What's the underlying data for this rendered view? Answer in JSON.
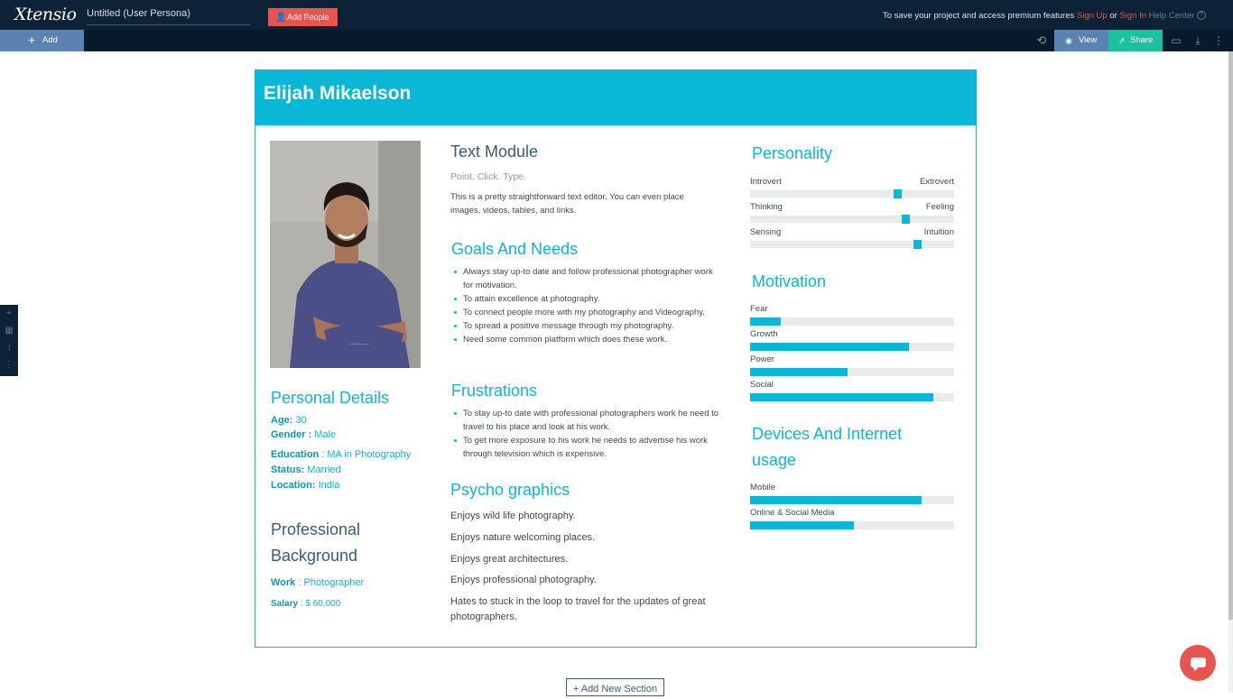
{
  "app": {
    "logo": "Xtensio",
    "doc_title": "Untitled (User Persona)",
    "add_people": "Add People",
    "save_message": "To save your project and access premium features",
    "sign_up": "Sign Up",
    "or": "or",
    "sign_in": "Sign In",
    "help_center": "Help Center"
  },
  "toolbar": {
    "add_label": "Add",
    "view_label": "View",
    "share_label": "Share"
  },
  "persona": {
    "name": "Elijah Mikaelson",
    "personal_details": {
      "title": "Personal Details",
      "age_label": "Age:",
      "age": "30",
      "gender_label": "Gender :",
      "gender": "Male",
      "education_label": "Education",
      "education": ": MA in Photography",
      "status_label": "Status:",
      "status": "Married",
      "location_label": "Location:",
      "location": "India"
    },
    "professional": {
      "title_line1": "Professional",
      "title_line2": "Background",
      "work_label": "Work",
      "work": ": Photographer",
      "salary_label": "Salary",
      "salary": ": $ 60,000"
    },
    "text_module": {
      "title": "Text Module",
      "subtitle": "Point. Click. Type.",
      "body": "This is a pretty straightforward text editor. You can even place images, videos, tables, and links."
    },
    "goals": {
      "title": "Goals And Needs",
      "items": [
        "Always stay up-to date and follow professional photographer work for motivation.",
        "To attain excellence at photography.",
        "To connect people more with my photography and Videography.",
        "To spread a positive message through my photography.",
        "Need some common platform which does these work."
      ]
    },
    "frustrations": {
      "title": "Frustrations",
      "items": [
        "To stay up-to date with professional photographers work he need to travel to his place and look at his work.",
        "To get more exposure to his work he needs to advertise his work through television which is expensive."
      ]
    },
    "psycho": {
      "title": "Psycho graphics",
      "items": [
        "Enjoys wild life photography.",
        "Enjoys nature welcoming places.",
        "Enjoys great architectures.",
        "Enjoys professional photography.",
        "Hates to stuck in the loop to  travel for the updates of great photographers."
      ]
    },
    "personality": {
      "title": "Personality",
      "traits": [
        {
          "left": "Introvert",
          "right": "Extrovert",
          "value": 0.72
        },
        {
          "left": "Thinking",
          "right": "Feeling",
          "value": 0.76
        },
        {
          "left": "Sensing",
          "right": "Intuition",
          "value": 0.82
        }
      ]
    },
    "motivation": {
      "title": "Motivation",
      "bars": [
        {
          "label": "Fear",
          "value": 0.15
        },
        {
          "label": "Growth",
          "value": 0.78
        },
        {
          "label": "Power",
          "value": 0.48
        },
        {
          "label": "Social",
          "value": 0.9
        }
      ]
    },
    "devices": {
      "title_line1": "Devices And Internet",
      "title_line2": "usage",
      "bars": [
        {
          "label": "Mobile",
          "value": 0.84
        },
        {
          "label": "Online & Social Media",
          "value": 0.51
        }
      ]
    }
  },
  "add_section": "+ Add New Section",
  "colors": {
    "accent": "#0bb7d6",
    "topbar": "#0d2137",
    "red": "#e8544f",
    "share": "#1bc1a0",
    "view": "#5b82b0"
  }
}
